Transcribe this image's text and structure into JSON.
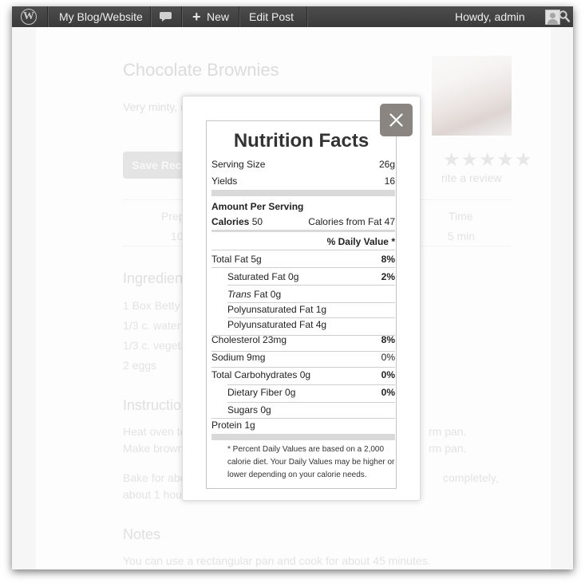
{
  "admin_bar": {
    "site_name": "My Blog/Website",
    "new_label": "New",
    "edit_post": "Edit Post",
    "greeting": "Howdy, admin"
  },
  "recipe": {
    "title": "Chocolate Brownies",
    "description": "Very minty, mou",
    "save_button": "Save Recipe",
    "stars": "★★★★★",
    "review_link": "rite a review",
    "prep_time_label": "Prep Tim",
    "prep_time_value": "10 min",
    "other_time_label": "Time",
    "other_time_value": "15 min",
    "ingredients_heading": "Ingredients",
    "ingredients": [
      "1 Box Betty Croc",
      "1/3 c. water",
      "1/3 c. vegetable",
      "2 eggs"
    ],
    "instructions_heading": "Instructions",
    "instructions": [
      {
        "left": "Heat oven to 350",
        "right": "rm pan."
      },
      {
        "left": "Make brownie m",
        "right": "rm pan."
      },
      {
        "left": "Bake for about 1",
        "right": "completely,"
      },
      {
        "left": "about 1 hour.",
        "right": ""
      }
    ],
    "notes_heading": "Notes",
    "notes": "You can use a rectangular pan and cook for about 45 minutes."
  },
  "nutrition": {
    "title": "Nutrition Facts",
    "serving_size_label": "Serving Size",
    "serving_size_value": "26g",
    "yields_label": "Yields",
    "yields_value": "16",
    "amount_per_serving": "Amount Per Serving",
    "calories_label": "Calories",
    "calories_value": "50",
    "calories_from_fat": "Calories from Fat 47",
    "daily_value_header": "% Daily Value *",
    "rows": {
      "total_fat": {
        "label": "Total Fat 5g",
        "pct": "8%"
      },
      "saturated_fat": {
        "label": "Saturated Fat 0g",
        "pct": "2%"
      },
      "trans_italic": "Trans",
      "trans_rest": " Fat 0g",
      "polyunsat": {
        "label": "Polyunsaturated Fat 1g"
      },
      "polyunsat2": {
        "label": "Polyunsaturated Fat 4g"
      },
      "cholesterol": {
        "label": "Cholesterol 23mg",
        "pct": "8%"
      },
      "sodium": {
        "label": "Sodium 9mg",
        "pct": "0%"
      },
      "carbs": {
        "label": "Total Carbohydrates 0g",
        "pct": "0%"
      },
      "fiber": {
        "label": "Dietary Fiber 0g",
        "pct": "0%"
      },
      "sugars": {
        "label": "Sugars 0g"
      },
      "protein": {
        "label": "Protein 1g"
      }
    },
    "footnote": "* Percent Daily Values are based on a 2,000 calorie diet. Your Daily Values may be higher or lower depending on your calorie needs."
  }
}
